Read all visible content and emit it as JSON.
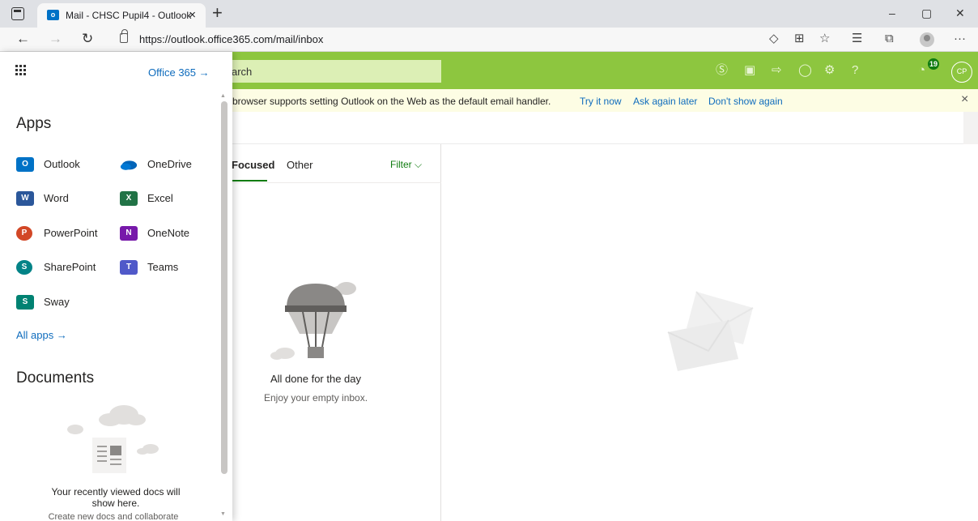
{
  "browser": {
    "tab_title": "Mail - CHSC Pupil4 - Outlook",
    "tab_close": "×",
    "new_tab": "+",
    "url": "https://outlook.office365.com/mail/inbox",
    "win_minimize": "–",
    "win_restore": "▢",
    "win_close": "✕",
    "menu": "···"
  },
  "header": {
    "search_placeholder": "arch",
    "notification_count": "19",
    "user_initials": "CP"
  },
  "notification": {
    "message": "browser supports setting Outlook on the Web as the default email handler.",
    "try_it_now": "Try it now",
    "ask_again_later": "Ask again later",
    "dont_show_again": "Don't show again",
    "close": "×"
  },
  "message_list": {
    "tab_focused": "Focused",
    "tab_other": "Other",
    "filter": "Filter ⌵",
    "empty_title": "All done for the day",
    "empty_sub": "Enjoy your empty inbox."
  },
  "launcher": {
    "office_link": "Office 365  →",
    "apps_title": "Apps",
    "apps": [
      {
        "label": "Outlook",
        "letter": "O"
      },
      {
        "label": "OneDrive",
        "letter": ""
      },
      {
        "label": "Word",
        "letter": "W"
      },
      {
        "label": "Excel",
        "letter": "X"
      },
      {
        "label": "PowerPoint",
        "letter": "P"
      },
      {
        "label": "OneNote",
        "letter": "N"
      },
      {
        "label": "SharePoint",
        "letter": "S"
      },
      {
        "label": "Teams",
        "letter": "T"
      },
      {
        "label": "Sway",
        "letter": "S"
      }
    ],
    "all_apps": "All apps  →",
    "documents_title": "Documents",
    "docs_empty_title": "Your recently viewed docs will show here.",
    "docs_empty_sub": "Create new docs and collaborate"
  },
  "colors": {
    "header_green": "#8dc63f",
    "accent_green": "#107c10",
    "link_blue": "#0f6cbd",
    "notification_bg": "#fdfde4"
  }
}
